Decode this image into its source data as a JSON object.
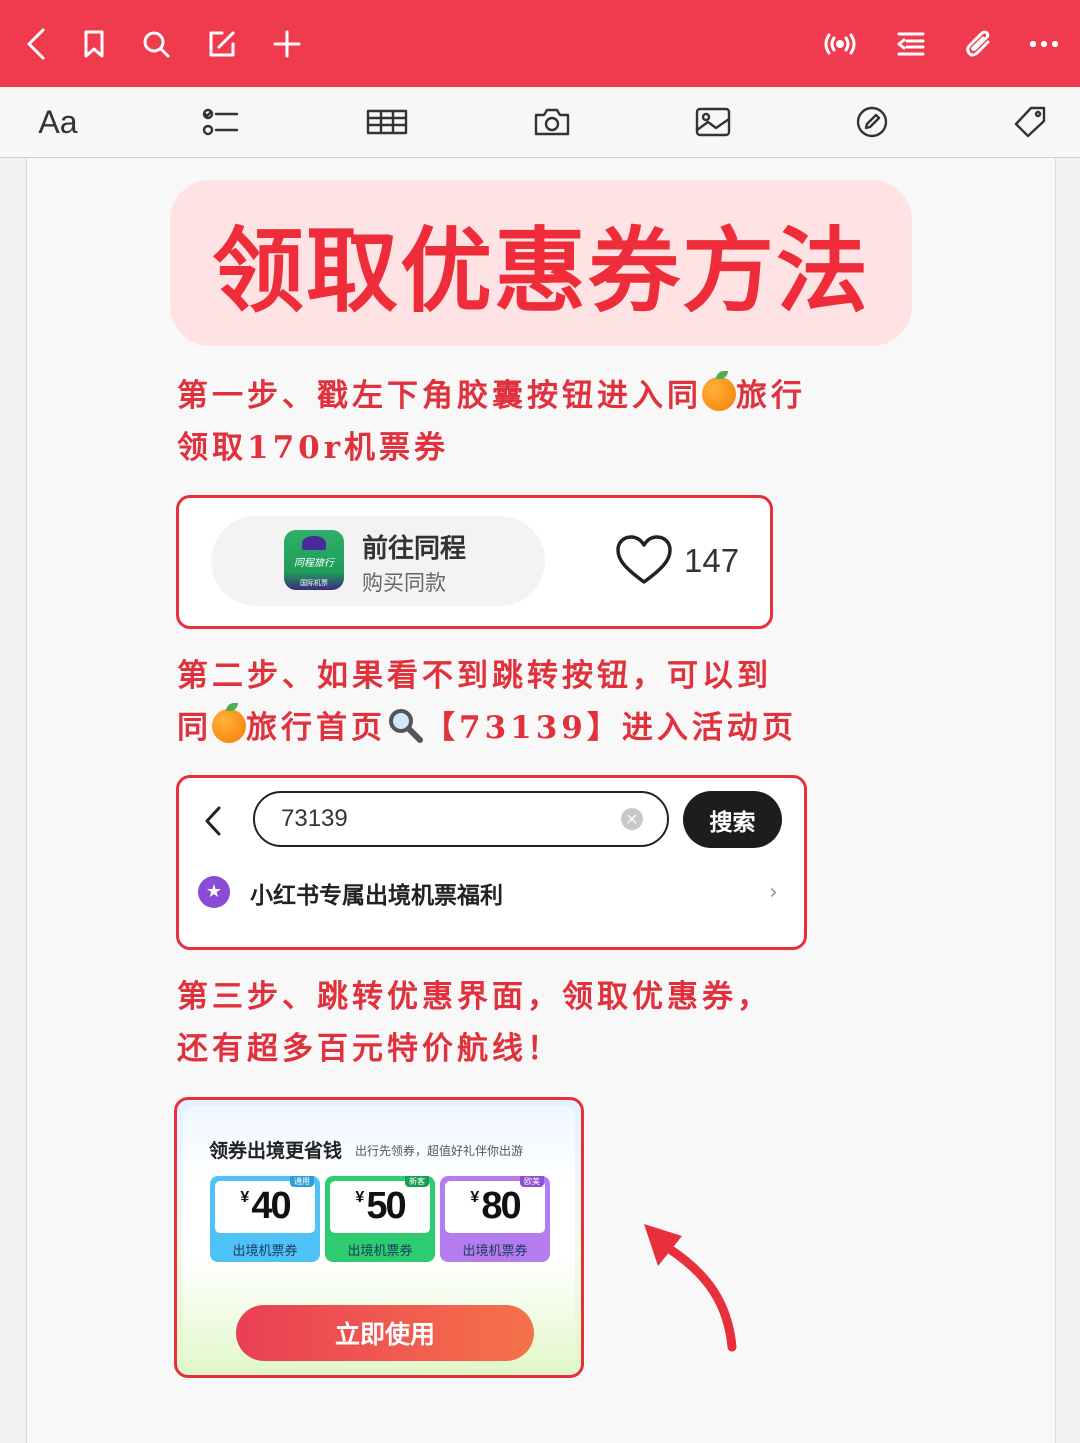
{
  "topbar": {
    "icons": [
      "back-icon",
      "bookmark-icon",
      "search-icon",
      "edit-icon",
      "add-icon",
      "broadcast-icon",
      "outline-icon",
      "attachment-icon",
      "more-icon"
    ]
  },
  "toolbar": {
    "font_label": "Aa",
    "icons": [
      "checklist-icon",
      "table-icon",
      "camera-icon",
      "image-icon",
      "draw-icon",
      "tag-icon"
    ]
  },
  "note": {
    "title": "领取优惠券方法",
    "step1": {
      "line1a": "第一步、戳左下角胶囊按钮进入同",
      "line1b": "旅行",
      "line2": "领取170r机票券"
    },
    "card1": {
      "app_logo_text": "同程旅行",
      "app_logo_sub": "国际机票",
      "title": "前往同程",
      "subtitle": "购买同款",
      "likes": "147"
    },
    "step2": {
      "line1": "第二步、如果看不到跳转按钮，可以到",
      "line2a": "同",
      "line2b": "旅行首页",
      "line2c": "【73139】进入活动页"
    },
    "card2": {
      "search_value": "73139",
      "search_button": "搜索",
      "result_text": "小红书专属出境机票福利"
    },
    "step3": {
      "line1": "第三步、跳转优惠界面，领取优惠券，",
      "line2": "还有超多百元特价航线！"
    },
    "card3": {
      "title": "领券出境更省钱",
      "subtitle": "出行先领券，超值好礼伴你出游",
      "coupons": [
        {
          "currency": "¥",
          "amount": "40",
          "label": "出境机票券",
          "tag": "通用",
          "color": "#4fc3f7"
        },
        {
          "currency": "¥",
          "amount": "50",
          "label": "出境机票券",
          "tag": "新客",
          "color": "#2ecc71"
        },
        {
          "currency": "¥",
          "amount": "80",
          "label": "出境机票券",
          "tag": "欧美",
          "color": "#b57cf0"
        }
      ],
      "button": "立即使用"
    }
  },
  "colors": {
    "brand_red": "#f03a4e",
    "step_text": "#e0313c",
    "title_bg": "#ffe3e4"
  }
}
